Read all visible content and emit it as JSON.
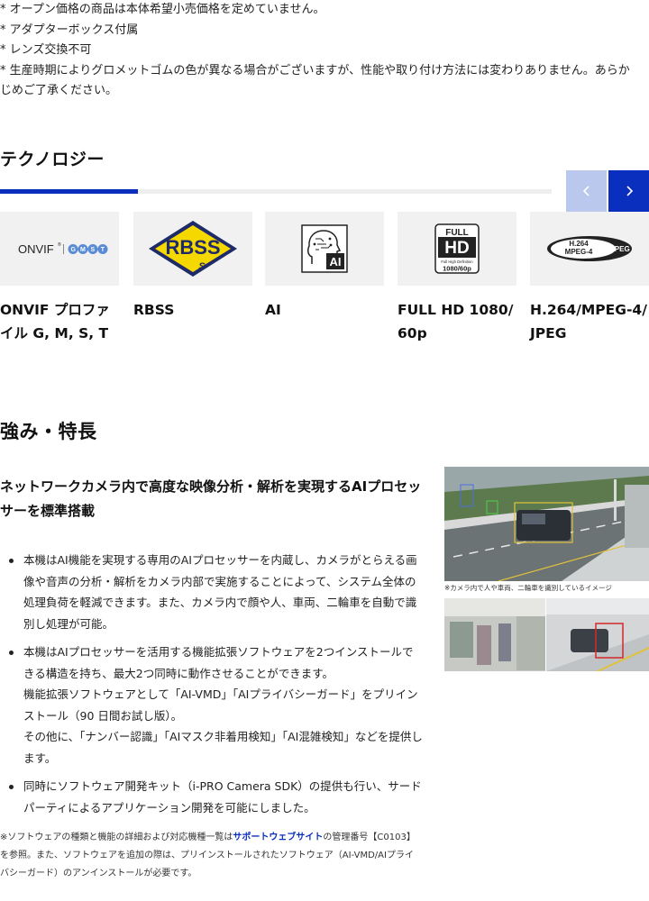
{
  "notes": [
    "* オープン価格の商品は本体希望小売価格を定めていません。",
    "* アダプターボックス付属",
    "* レンズ交換不可",
    "* 生産時期によりグロメットゴムの色が異なる場合がございますが、性能や取り付け方法には変わりありません。あらか",
    "じめご了承ください。"
  ],
  "technology": {
    "title": "テクノロジー",
    "progress": 0.25,
    "prev_label": "‹",
    "next_label": "›",
    "cards": [
      {
        "label": "ONVIF プロファイル G, M, S, T",
        "logo": "ONVIF",
        "logo_suffix": "GMST",
        "icon": "onvif-logo"
      },
      {
        "label": "RBSS",
        "logo": "RBSS",
        "logo_mark": "S",
        "icon": "rbss-logo"
      },
      {
        "label": "AI",
        "logo": "AI",
        "icon": "ai-head-icon"
      },
      {
        "label": "FULL HD 1080/60p",
        "logo_top": "FULL",
        "logo_mid": "HD",
        "logo_small": "Full High Definition",
        "logo_bottom": "1080/60p",
        "icon": "full-hd-icon"
      },
      {
        "label": "H.264/MPEG-4/JPEG",
        "logo_h264": "H.264",
        "logo_mpeg": "MPEG-4",
        "logo_jpeg": "JPEG",
        "icon": "codec-logo"
      }
    ]
  },
  "features": {
    "title": "強み・特長",
    "subtitle": "ネットワークカメラ内で高度な映像分析・解析を実現するAIプロセッサーを標準搭載",
    "bullets": [
      [
        "本機はAI機能を実現する専用のAIプロセッサーを内蔵し、カメラがとらえる画像や音声の分析・解析をカメラ内部で実施することによって、システム全体の処理負荷を軽減できます。また、カメラ内で顔や人、車両、二輪車を自動で識別し処理が可能。"
      ],
      [
        "本機はAIプロセッサーを活用する機能拡張ソフトウェアを2つインストールできる構造を持ち、最大2つ同時に動作させることができます。",
        "機能拡張ソフトウェアとして「AI-VMD」「AIプライバシーガード」をプリインストール（90 日間お試し版）。",
        "その他に、「ナンバー認識」「AIマスク非着用検知」「AI混雑検知」などを提供します。"
      ],
      [
        "同時にソフトウェア開発キット（i-PRO Camera SDK）の提供も行い、サードパーティによるアプリケーション開発を可能にしました。"
      ]
    ],
    "footnote_before": "※ソフトウェアの種類と機能の詳細および対応機種一覧は",
    "footnote_link": "サポートウェブサイト",
    "footnote_after": "の管理番号【C0103】を参照。また、ソフトウェアを追加の際は、プリインストールされたソフトウェア（AI-VMD/AIプライバシーガード）のアンインストールが必要です。",
    "image_caption": "※カメラ内で人や車両、二輪車を識別しているイメージ"
  },
  "colors": {
    "accent": "#0a2ebe",
    "accent_light": "#b9c8ec",
    "card_bg": "#f1f1f1"
  }
}
